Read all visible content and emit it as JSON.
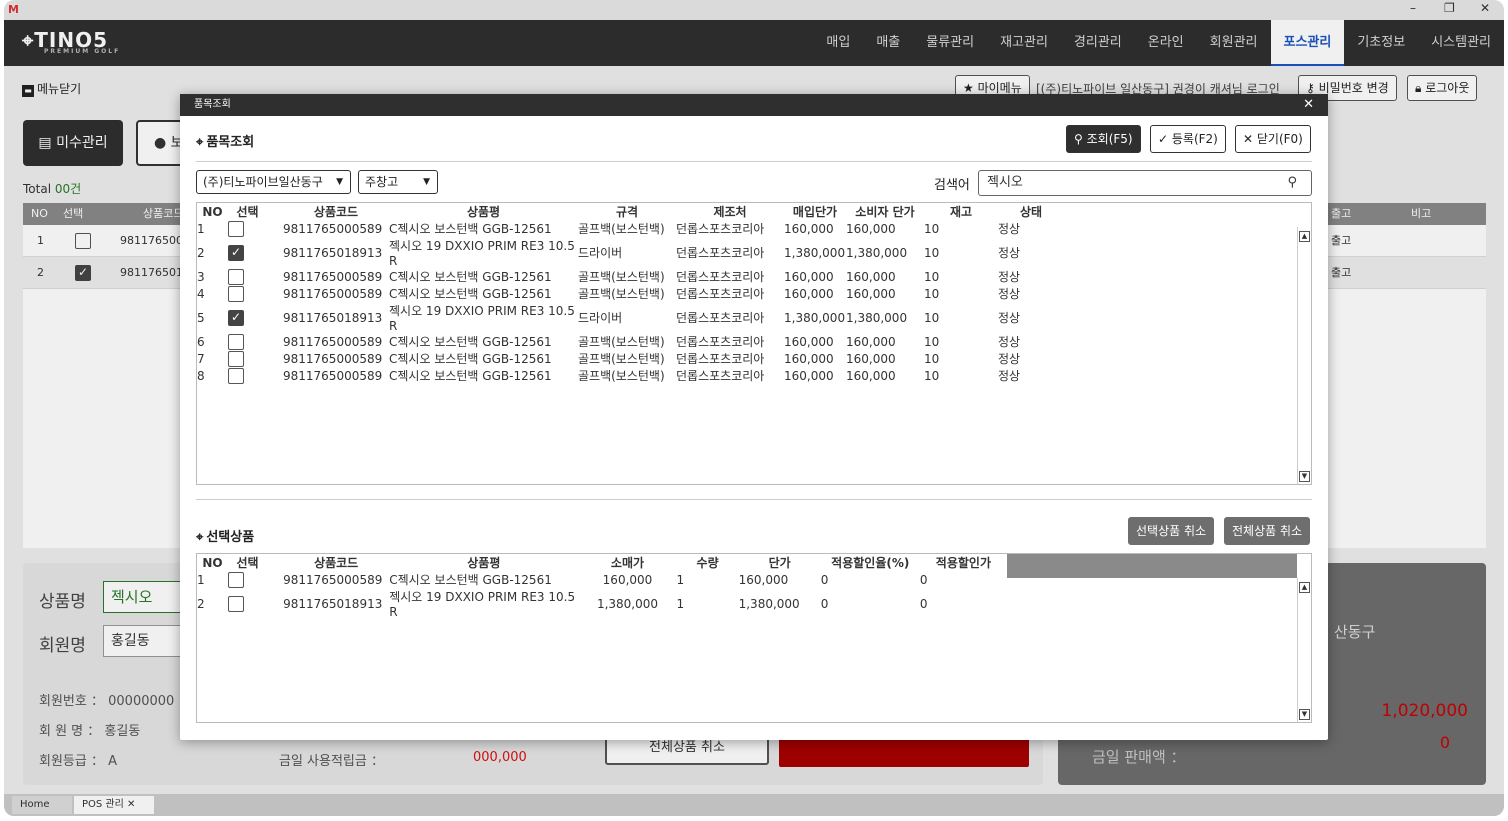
{
  "window": {
    "minimize": "–",
    "restore": "❐",
    "close": "✕"
  },
  "app": {
    "logo": "TINO5",
    "logo_sub": "PREMIUM GOLF"
  },
  "nav": {
    "items": [
      "매입",
      "매출",
      "물류관리",
      "재고관리",
      "경리관리",
      "온라인",
      "회원관리",
      "포스관리",
      "기초정보",
      "시스템관리"
    ],
    "active": "포스관리"
  },
  "subbar": {
    "menu_close": "메뉴닫기",
    "mymenu": "★ 마이메뉴",
    "user_info": "[(주)티노파이브 일산동구] 권경이 캐셔님 로그인",
    "change_pw": "비밀번호 변경",
    "logout": "로그아웃"
  },
  "background": {
    "btn_misu": "미수관리",
    "btn_other": "● 보",
    "total_label": "Total",
    "total_value": "00건",
    "table_headers": {
      "no": "NO",
      "select": "선택",
      "code": "상품코드",
      "out": "출고",
      "note": "비고"
    },
    "rows": [
      {
        "no": "1",
        "code": "981176500",
        "out": "출고"
      },
      {
        "no": "2",
        "code": "981176501",
        "out": "출고"
      }
    ],
    "product_name_label": "상품명",
    "product_name_value": "젝시오",
    "member_name_label": "회원명",
    "member_name_value": "홍길동",
    "member_no_label": "회원번호 ：",
    "member_no_value": "00000000",
    "member_nm_label": "회 원 명 ：",
    "member_nm_value": "홍길동",
    "member_grade_label": "회원등급 ：",
    "member_grade_value": "A",
    "today_points_label": "금일 사용적립금 ：",
    "today_points_value": "000,000",
    "cancel_all_btn": "전체상품 취소",
    "right_store": "산동구",
    "right_amount": "1,020,000",
    "right_zero": "0",
    "today_sales_label": "금일 판매액 ："
  },
  "tabs": {
    "home": "Home",
    "pos": "POS 관리",
    "close": "✕"
  },
  "modal": {
    "title": "품목조회",
    "close": "✕",
    "section1": "품목조회",
    "section_icon": "⌖",
    "btn_search": "조회(F5)",
    "btn_register": "등록(F2)",
    "btn_close": "닫기(F0)",
    "store_select": "(주)티노파이브일산동구",
    "warehouse_select": "주창고",
    "search_label": "검색어",
    "search_value": "젝시오",
    "headers": {
      "no": "NO",
      "select": "선택",
      "code": "상품코드",
      "name": "상품평",
      "spec": "규격",
      "maker": "제조처",
      "buy_price": "매입단가",
      "consumer_price": "소비자 단가",
      "stock": "재고",
      "status": "상태"
    },
    "rows": [
      {
        "no": "1",
        "checked": false,
        "code": "9811765000589",
        "name": "C젝시오 보스턴백 GGB-12561",
        "spec": "골프백(보스턴백)",
        "maker": "던롭스포츠코리아",
        "buy": "160,000",
        "consumer": "160,000",
        "stock": "10",
        "status": "정상"
      },
      {
        "no": "2",
        "checked": true,
        "code": "9811765018913",
        "name": "젝시오 19 DXXIO PRIM RE3 10.5 R",
        "spec": "드라이버",
        "maker": "던롭스포츠코리아",
        "buy": "1,380,000",
        "consumer": "1,380,000",
        "stock": "10",
        "status": "정상"
      },
      {
        "no": "3",
        "checked": false,
        "code": "9811765000589",
        "name": "C젝시오 보스턴백 GGB-12561",
        "spec": "골프백(보스턴백)",
        "maker": "던롭스포츠코리아",
        "buy": "160,000",
        "consumer": "160,000",
        "stock": "10",
        "status": "정상"
      },
      {
        "no": "4",
        "checked": false,
        "code": "9811765000589",
        "name": "C젝시오 보스턴백 GGB-12561",
        "spec": "골프백(보스턴백)",
        "maker": "던롭스포츠코리아",
        "buy": "160,000",
        "consumer": "160,000",
        "stock": "10",
        "status": "정상"
      },
      {
        "no": "5",
        "checked": true,
        "code": "9811765018913",
        "name": "젝시오 19 DXXIO PRIM RE3 10.5 R",
        "spec": "드라이버",
        "maker": "던롭스포츠코리아",
        "buy": "1,380,000",
        "consumer": "1,380,000",
        "stock": "10",
        "status": "정상"
      },
      {
        "no": "6",
        "checked": false,
        "code": "9811765000589",
        "name": "C젝시오 보스턴백 GGB-12561",
        "spec": "골프백(보스턴백)",
        "maker": "던롭스포츠코리아",
        "buy": "160,000",
        "consumer": "160,000",
        "stock": "10",
        "status": "정상"
      },
      {
        "no": "7",
        "checked": false,
        "code": "9811765000589",
        "name": "C젝시오 보스턴백 GGB-12561",
        "spec": "골프백(보스턴백)",
        "maker": "던롭스포츠코리아",
        "buy": "160,000",
        "consumer": "160,000",
        "stock": "10",
        "status": "정상"
      },
      {
        "no": "8",
        "checked": false,
        "code": "9811765000589",
        "name": "C젝시오 보스턴백 GGB-12561",
        "spec": "골프백(보스턴백)",
        "maker": "던롭스포츠코리아",
        "buy": "160,000",
        "consumer": "160,000",
        "stock": "10",
        "status": "정상"
      }
    ],
    "section2": "선택상품",
    "btn_cancel_selected": "선택상품 취소",
    "btn_cancel_all": "전체상품 취소",
    "sel_headers": {
      "no": "NO",
      "select": "선택",
      "code": "상품코드",
      "name": "상품평",
      "retail": "소매가",
      "qty": "수량",
      "unit": "단가",
      "rate": "적용할인율(%)",
      "disc": "적용할인가"
    },
    "sel_rows": [
      {
        "no": "1",
        "code": "9811765000589",
        "name": "C젝시오 보스턴백 GGB-12561",
        "retail": "160,000",
        "qty": "1",
        "unit": "160,000",
        "rate": "0",
        "disc": "0"
      },
      {
        "no": "2",
        "code": "9811765018913",
        "name": "젝시오 19 DXXIO PRIM RE3 10.5 R",
        "retail": "1,380,000",
        "qty": "1",
        "unit": "1,380,000",
        "rate": "0",
        "disc": "0"
      }
    ]
  },
  "colors": {
    "accent": "#1a56c4",
    "dark": "#2f2f2f",
    "price_red": "#d11111",
    "header_gray": "#8a8a8a"
  }
}
